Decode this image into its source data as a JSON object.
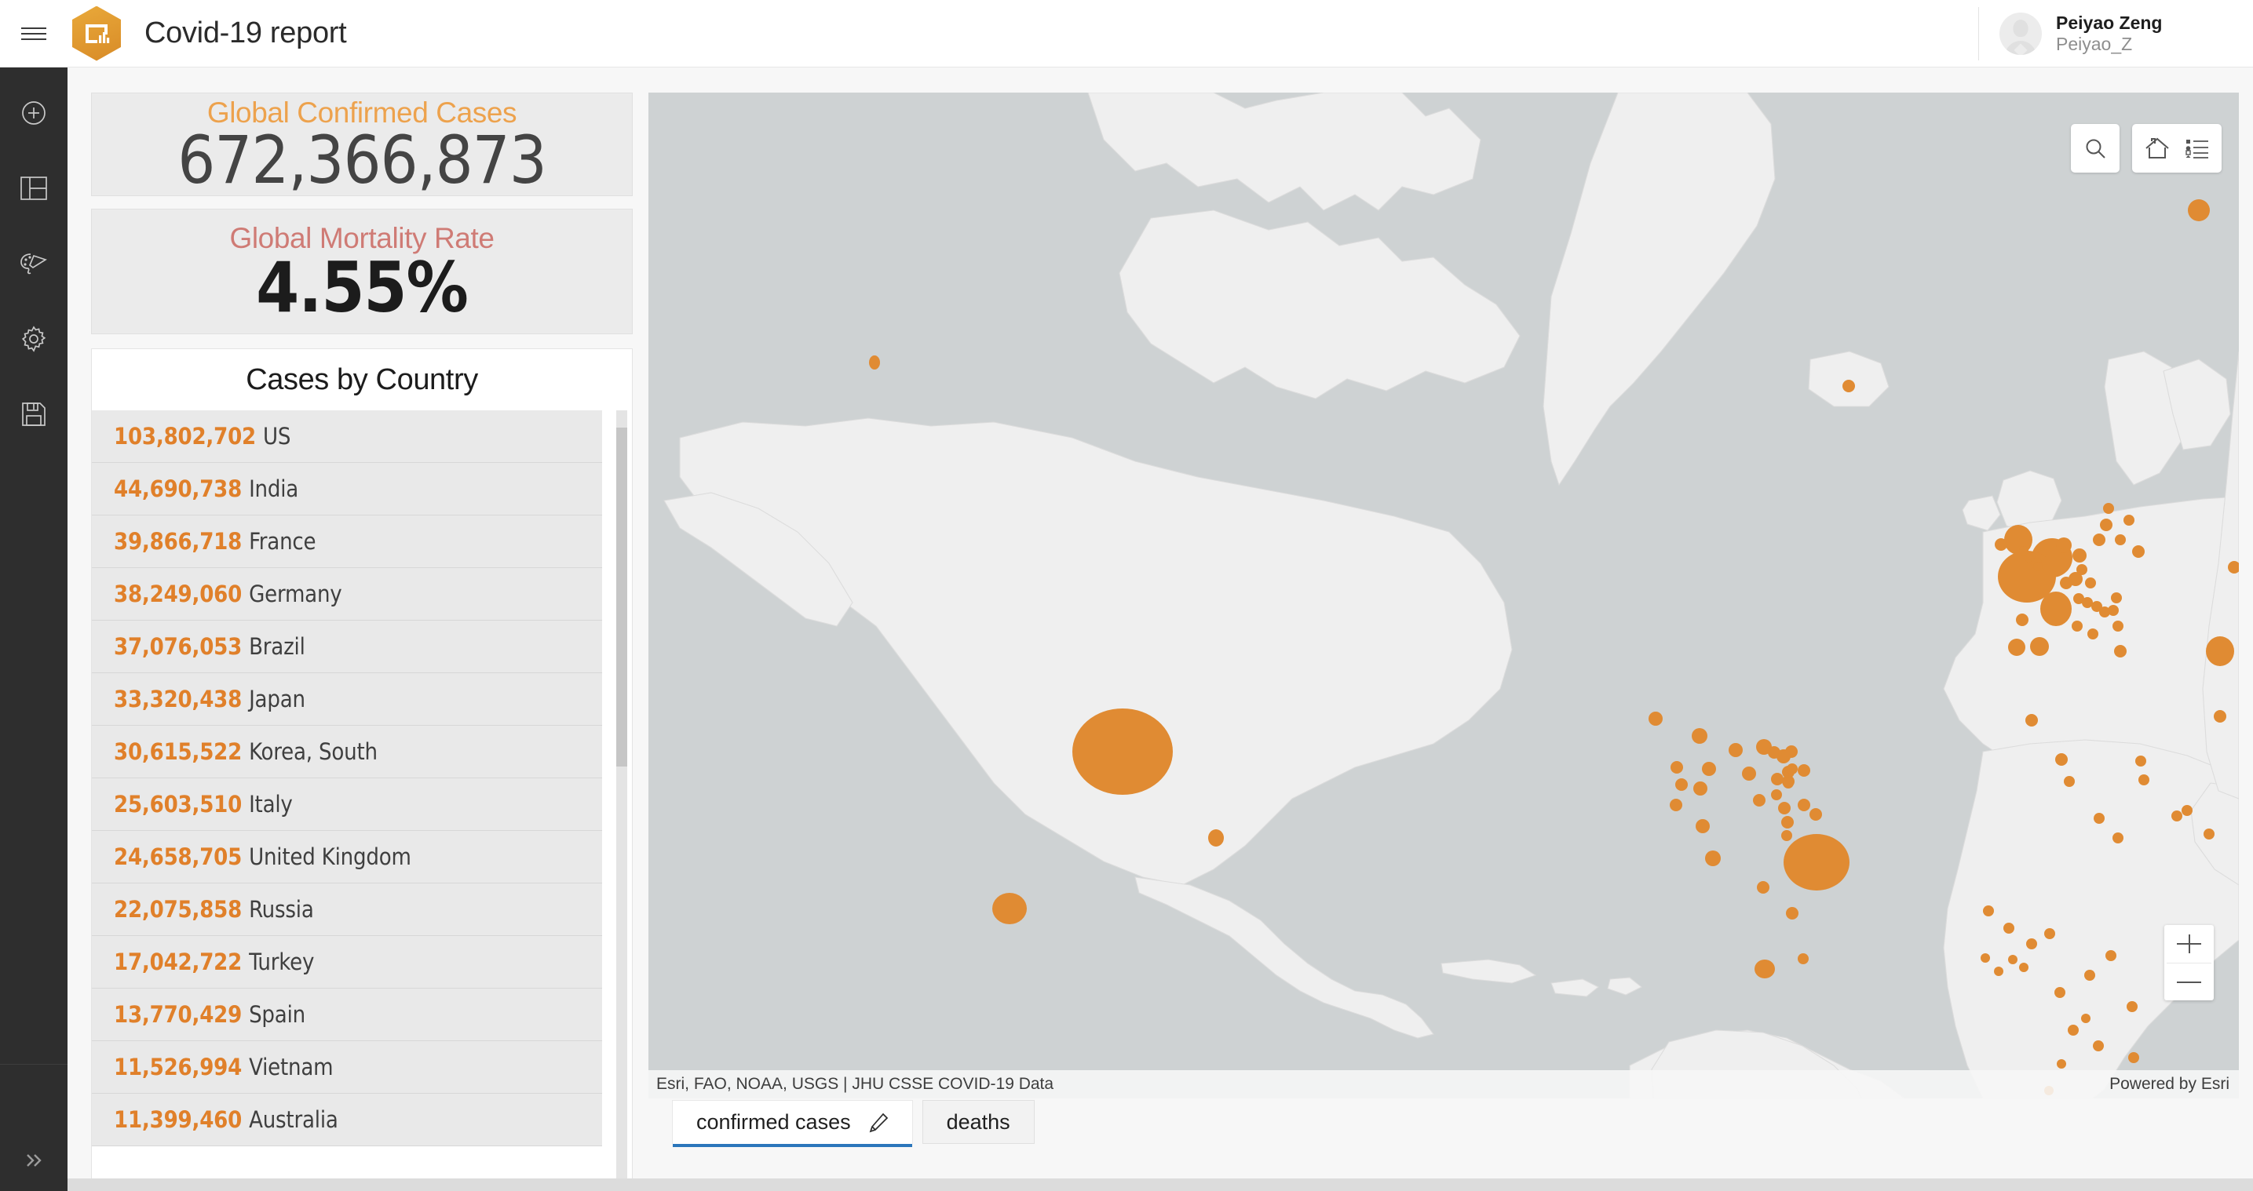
{
  "header": {
    "menu_icon": "hamburger-icon",
    "logo_icon": "dashboard-app-icon",
    "title": "Covid-19 report",
    "user": {
      "full_name": "Peiyao Zeng",
      "handle": "Peiyao_Z",
      "avatar_icon": "user-avatar-icon"
    }
  },
  "sidebar": {
    "items": [
      {
        "name": "add",
        "icon": "plus-circle-icon"
      },
      {
        "name": "layout",
        "icon": "layout-panels-icon"
      },
      {
        "name": "theme",
        "icon": "palette-brush-icon"
      },
      {
        "name": "settings",
        "icon": "gear-icon"
      },
      {
        "name": "save",
        "icon": "floppy-disk-save-icon"
      }
    ],
    "expand": {
      "name": "expand",
      "icon": "chevron-double-right-icon"
    }
  },
  "kpis": [
    {
      "title": "Global Confirmed Cases",
      "value": "672,366,873",
      "color": "#eda24d"
    },
    {
      "title": "Global Mortality Rate",
      "value": "4.55%",
      "color": "#cf7b75"
    }
  ],
  "country_list": {
    "title": "Cases by Country",
    "rows": [
      {
        "count": "103,802,702",
        "country": "US"
      },
      {
        "count": "44,690,738",
        "country": "India"
      },
      {
        "count": "39,866,718",
        "country": "France"
      },
      {
        "count": "38,249,060",
        "country": "Germany"
      },
      {
        "count": "37,076,053",
        "country": "Brazil"
      },
      {
        "count": "33,320,438",
        "country": "Japan"
      },
      {
        "count": "30,615,522",
        "country": "Korea, South"
      },
      {
        "count": "25,603,510",
        "country": "Italy"
      },
      {
        "count": "24,658,705",
        "country": "United Kingdom"
      },
      {
        "count": "22,075,858",
        "country": "Russia"
      },
      {
        "count": "17,042,722",
        "country": "Turkey"
      },
      {
        "count": "13,770,429",
        "country": "Spain"
      },
      {
        "count": "11,526,994",
        "country": "Vietnam"
      },
      {
        "count": "11,399,460",
        "country": "Australia"
      }
    ]
  },
  "map": {
    "attribution": "Esri, FAO, NOAA, USGS | JHU CSSE COVID-19 Data",
    "powered_by": "Powered by Esri",
    "tools": [
      {
        "name": "search",
        "icon": "search-icon"
      },
      {
        "name": "home",
        "icon": "home-icon"
      },
      {
        "name": "legend",
        "icon": "legend-list-icon"
      }
    ],
    "zoom_in": "+",
    "zoom_out": "−",
    "colors": {
      "ocean": "#ced2d3",
      "land": "#efefef",
      "symbol": "#e08b33"
    }
  },
  "tabs": [
    {
      "label": "confirmed cases",
      "active": true,
      "edit_icon": "pencil-icon"
    },
    {
      "label": "deaths",
      "active": false
    }
  ],
  "chart_data": {
    "type": "bar",
    "title": "Cases by Country",
    "xlabel": "",
    "ylabel": "Confirmed cases",
    "categories": [
      "US",
      "India",
      "France",
      "Germany",
      "Brazil",
      "Japan",
      "Korea, South",
      "Italy",
      "United Kingdom",
      "Russia",
      "Turkey",
      "Spain",
      "Vietnam",
      "Australia"
    ],
    "values": [
      103802702,
      44690738,
      39866718,
      38249060,
      37076053,
      33320438,
      30615522,
      25603510,
      24658705,
      22075858,
      17042722,
      13770429,
      11526994,
      11399460
    ],
    "global_confirmed_cases": 672366873,
    "global_mortality_rate_pct": 4.55
  }
}
